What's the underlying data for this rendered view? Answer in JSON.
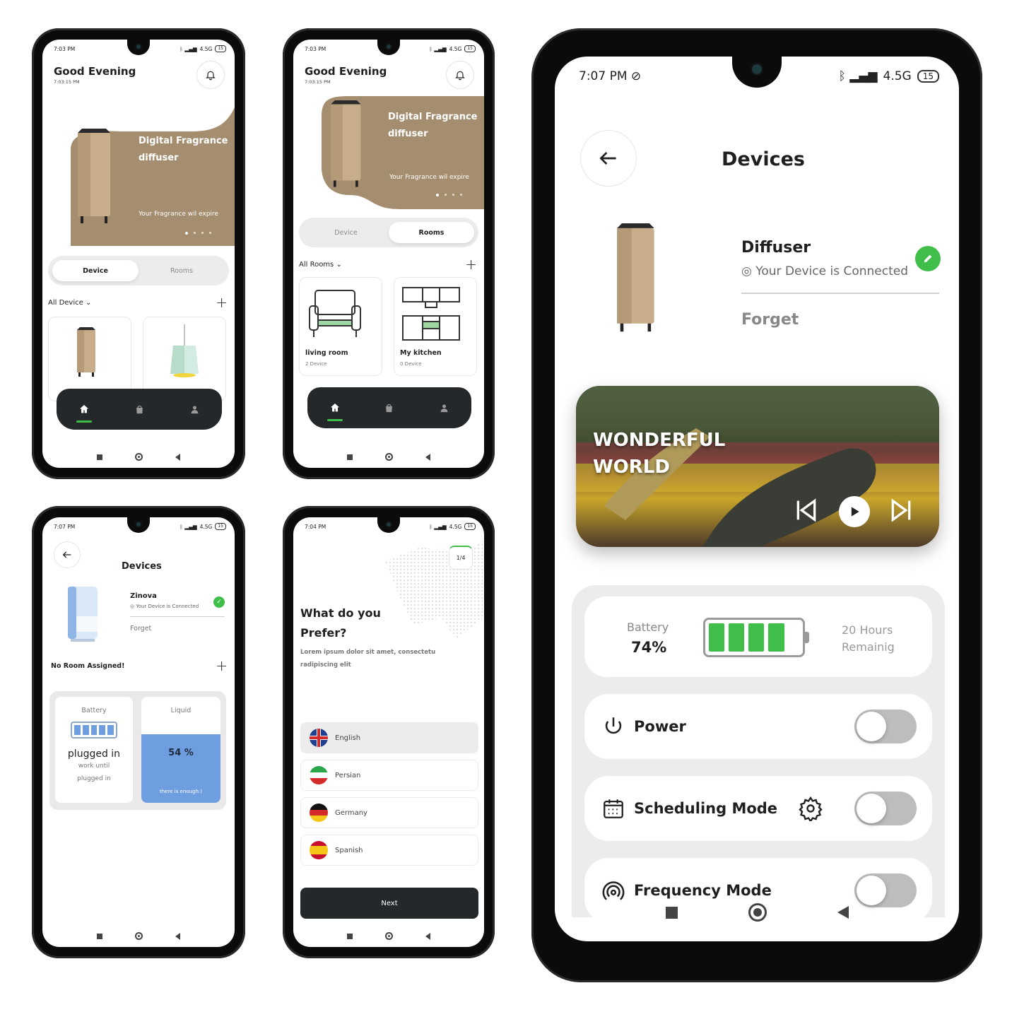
{
  "status": {
    "time_home": "7:03 PM",
    "time_devices": "7:07 PM",
    "time_lang": "7:04 PM",
    "network": "4.5G",
    "battery": "15"
  },
  "home": {
    "greeting": "Good Evening",
    "clock": "7:03:15 PM",
    "banner_title_1": "Digital Fragrance",
    "banner_title_2": "diffuser",
    "banner_sub": "Your Fragrance wil expire",
    "seg_device": "Device",
    "seg_rooms": "Rooms",
    "all_device": "All Device",
    "all_rooms": "All Rooms",
    "rooms": [
      {
        "name": "living room",
        "count": "2 Device"
      },
      {
        "name": "My kitchen",
        "count": "0 Device"
      }
    ]
  },
  "small_device": {
    "title": "Devices",
    "name": "Zinova",
    "connected": "Your Device is Connected",
    "forget": "Forget",
    "no_room": "No Room Assigned!",
    "battery_label": "Battery",
    "battery_status": "plugged in",
    "battery_note_1": "work until",
    "battery_note_2": "plugged in",
    "liquid_label": "Liquid",
    "liquid_value": "54 %",
    "liquid_level": 0.54,
    "liquid_note": "there is enough:)"
  },
  "language": {
    "step": "1/4",
    "heading_1": "What do you",
    "heading_2": "Prefer?",
    "desc_1": "Lorem ipsum dolor sit amet, consectetu",
    "desc_2": "radipiscing elit",
    "options": [
      "English",
      "Persian",
      "Germany",
      "Spanish"
    ],
    "next": "Next"
  },
  "big_device": {
    "title": "Devices",
    "name": "Diffuser",
    "connected": "Your Device is Connected",
    "forget": "Forget",
    "media_title_1": "WONDERFUL",
    "media_title_2": "WORLD",
    "battery_label": "Battery",
    "battery_value": "74%",
    "remaining_1": "20 Hours",
    "remaining_2": "Remainig",
    "controls": [
      "Power",
      "Scheduling Mode",
      "Frequency Mode"
    ]
  },
  "colors": {
    "accent_green": "#3fbf4a",
    "banner_brown": "#a58e70",
    "dark": "#25282b",
    "liquid_blue": "#6e9ee0"
  }
}
